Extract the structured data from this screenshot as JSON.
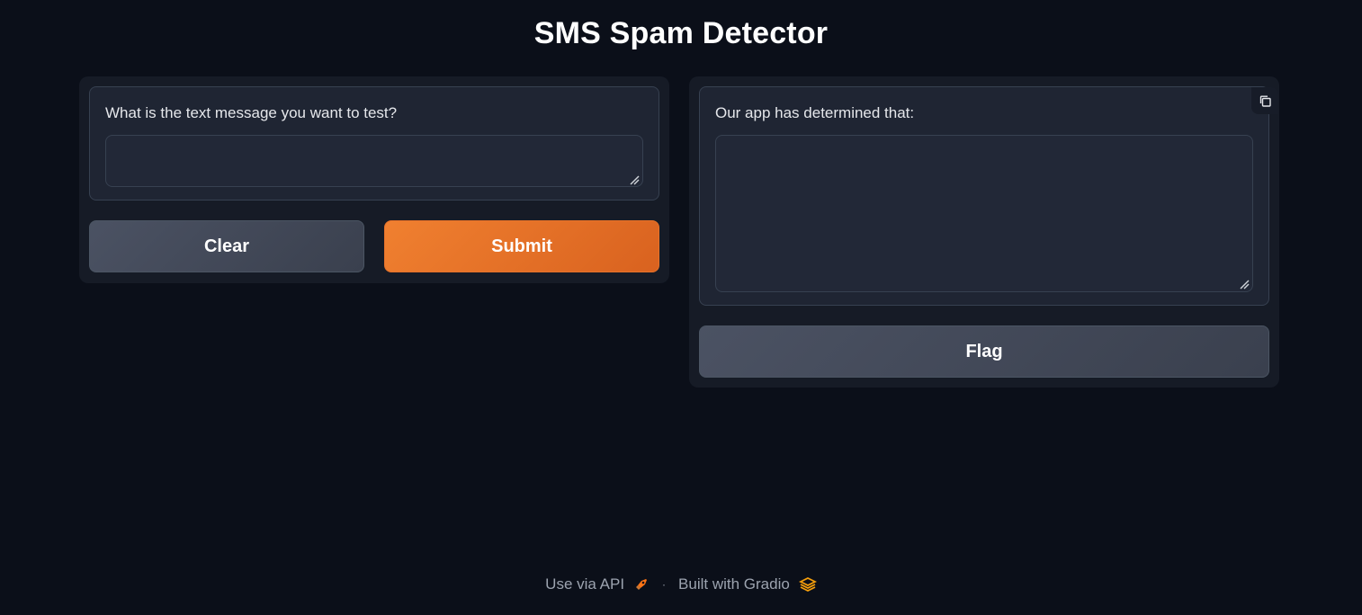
{
  "app": {
    "title": "SMS Spam Detector"
  },
  "input_panel": {
    "label": "What is the text message you want to test?",
    "value": "",
    "placeholder": "",
    "clear_label": "Clear",
    "submit_label": "Submit"
  },
  "output_panel": {
    "label": "Our app has determined that:",
    "value": "",
    "flag_label": "Flag",
    "copy_icon": "copy-icon"
  },
  "footer": {
    "api_label": "Use via API",
    "separator": "·",
    "built_label": "Built with Gradio",
    "api_icon": "rocket-icon",
    "gradio_icon": "gradio-logo-icon"
  },
  "colors": {
    "background": "#0b0f19",
    "panel": "#161b26",
    "block": "#1f2533",
    "primary": "#f08030",
    "secondary": "#4b5263"
  }
}
